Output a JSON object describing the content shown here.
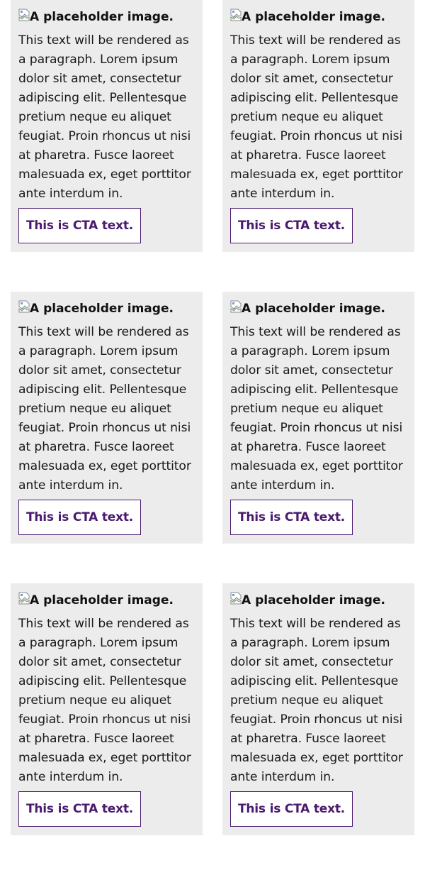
{
  "cards": [
    {
      "image_alt": "A placeholder image.",
      "body": "This text will be rendered as a paragraph. Lorem ipsum dolor sit amet, consectetur adipiscing elit. Pellentesque pretium neque eu aliquet feugiat. Proin rhoncus ut nisi at pharetra. Fusce laoreet malesuada ex, eget porttitor ante interdum in.",
      "cta": "This is CTA text."
    },
    {
      "image_alt": "A placeholder image.",
      "body": "This text will be rendered as a paragraph. Lorem ipsum dolor sit amet, consectetur adipiscing elit. Pellentesque pretium neque eu aliquet feugiat. Proin rhoncus ut nisi at pharetra. Fusce laoreet malesuada ex, eget porttitor ante interdum in.",
      "cta": "This is CTA text."
    },
    {
      "image_alt": "A placeholder image.",
      "body": "This text will be rendered as a paragraph. Lorem ipsum dolor sit amet, consectetur adipiscing elit. Pellentesque pretium neque eu aliquet feugiat. Proin rhoncus ut nisi at pharetra. Fusce laoreet malesuada ex, eget porttitor ante interdum in.",
      "cta": "This is CTA text."
    },
    {
      "image_alt": "A placeholder image.",
      "body": "This text will be rendered as a paragraph. Lorem ipsum dolor sit amet, consectetur adipiscing elit. Pellentesque pretium neque eu aliquet feugiat. Proin rhoncus ut nisi at pharetra. Fusce laoreet malesuada ex, eget porttitor ante interdum in.",
      "cta": "This is CTA text."
    },
    {
      "image_alt": "A placeholder image.",
      "body": "This text will be rendered as a paragraph. Lorem ipsum dolor sit amet, consectetur adipiscing elit. Pellentesque pretium neque eu aliquet feugiat. Proin rhoncus ut nisi at pharetra. Fusce laoreet malesuada ex, eget porttitor ante interdum in.",
      "cta": "This is CTA text."
    },
    {
      "image_alt": "A placeholder image.",
      "body": "This text will be rendered as a paragraph. Lorem ipsum dolor sit amet, consectetur adipiscing elit. Pellentesque pretium neque eu aliquet feugiat. Proin rhoncus ut nisi at pharetra. Fusce laoreet malesuada ex, eget porttitor ante interdum in.",
      "cta": "This is CTA text."
    }
  ],
  "colors": {
    "card_background": "#ececec",
    "cta_accent": "#4a1a6e",
    "text": "#1a1a1a"
  },
  "icons": {
    "broken_image": "broken-image-icon"
  }
}
